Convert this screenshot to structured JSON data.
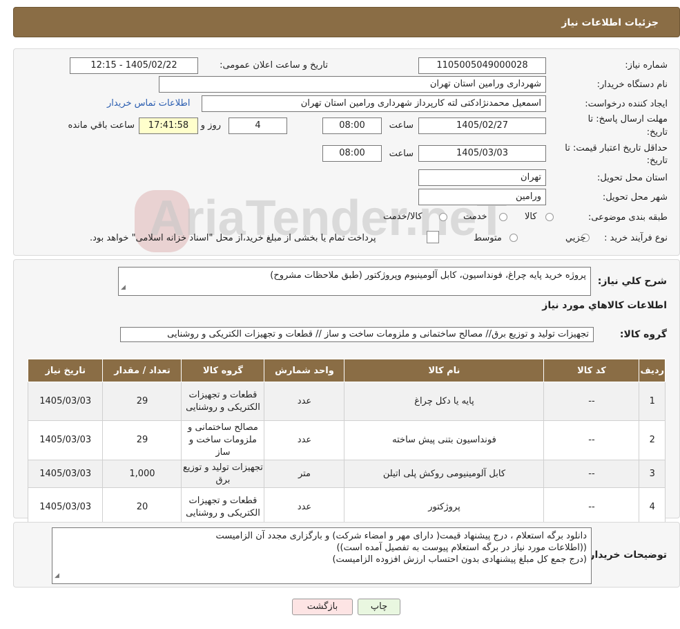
{
  "header": {
    "title": "جزئیات اطلاعات نیاز"
  },
  "fields": {
    "need_number_label": "شماره نیاز:",
    "need_number": "1105005049000028",
    "announce_label": "تاریخ و ساعت اعلان عمومی:",
    "announce_value": "1405/02/22 - 12:15",
    "buyer_org_label": "نام دستگاه خریدار:",
    "buyer_org": "شهرداری ورامین استان تهران",
    "requester_label": "ایجاد کننده درخواست:",
    "requester": "اسمعیل محمدنژادکتی لته کارپرداز شهرداری ورامین استان تهران",
    "contact_link": "اطلاعات تماس خریدار",
    "deadline_label_1": "مهلت ارسال پاسخ: تا",
    "deadline_label_2": "تاریخ:",
    "deadline_date": "1405/02/27",
    "time_label": "ساعت",
    "deadline_time": "08:00",
    "days_value": "4",
    "days_label": "روز و",
    "remaining_time": "17:41:58",
    "remaining_label": "ساعت باقي مانده",
    "validity_label_1": "حداقل تاریخ اعتبار قیمت: تا",
    "validity_label_2": "تاریخ:",
    "validity_date": "1405/03/03",
    "validity_time": "08:00",
    "province_label": "استان محل تحویل:",
    "province": "تهران",
    "city_label": "شهر محل تحویل:",
    "city": "ورامین",
    "category_label": "طبقه بندی موضوعی:",
    "category_options": [
      "کالا",
      "خدمت",
      "کالا/خدمت"
    ],
    "process_label": "نوع فرآیند خرید :",
    "process_options": [
      "جزیي",
      "متوسط"
    ],
    "process_note": "پرداخت تمام یا بخشی از مبلغ خرید،از محل \"اسناد خزانه اسلامی\" خواهد بود."
  },
  "description": {
    "label": "شرح کلي نیاز:",
    "text": "پروژه خرید پایه چراغ، فونداسیون، کابل آلومینیوم وپروژکتور (طبق ملاحظات مشروح)"
  },
  "goods": {
    "section_title": "اطلاعات کالاهاي مورد نیاز",
    "group_label": "گروه کالا:",
    "group_value": "تجهیزات تولید و توزیع برق// مصالح ساختمانی و ملزومات ساخت و ساز // قطعات و تجهیزات الکتریکی و روشنایی"
  },
  "table": {
    "headers": [
      "ردیف",
      "کد کالا",
      "نام کالا",
      "واحد شمارش",
      "گروه کالا",
      "تعداد / مقدار",
      "تاریخ نیاز"
    ],
    "rows": [
      [
        "1",
        "--",
        "پایه یا دکل چراغ",
        "عدد",
        "قطعات و تجهیزات الکتریکی و روشنایی",
        "29",
        "1405/03/03"
      ],
      [
        "2",
        "--",
        "فونداسیون بتنی پیش ساخته",
        "عدد",
        "مصالح ساختمانی و ملزومات ساخت و ساز",
        "29",
        "1405/03/03"
      ],
      [
        "3",
        "--",
        "کابل آلومینیومی روکش پلی اتیلن",
        "متر",
        "تجهیزات تولید و توزیع برق",
        "1,000",
        "1405/03/03"
      ],
      [
        "4",
        "--",
        "پروژکتور",
        "عدد",
        "قطعات و تجهیزات الکتریکی و روشنایی",
        "20",
        "1405/03/03"
      ]
    ]
  },
  "buyer_notes": {
    "label": "توضیحات خریدار:",
    "lines": [
      "دانلود برگه استعلام ، درج پیشنهاد قیمت( دارای مهر و امضاء شرکت) و بارگزاری مجدد آن الزامیست",
      "((اطلاعات مورد نیاز در برگه استعلام پیوست به تفصیل آمده است))",
      "(درج  جمع کل مبلغ پیشنهادی بدون احتساب ارزش افزوده الزامیست)"
    ]
  },
  "buttons": {
    "print": "چاپ",
    "back": "بازگشت"
  },
  "watermark": {
    "text": "AriaTender.neT"
  },
  "colors": {
    "header": "#8a6d45",
    "back_button": "#fde4e4",
    "print_button": "#e9f7e0",
    "link": "#2a5db0"
  }
}
